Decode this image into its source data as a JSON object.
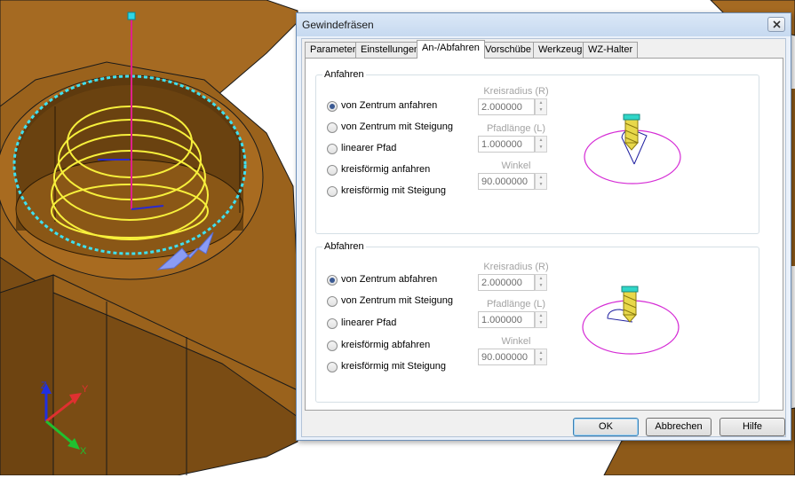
{
  "dialog": {
    "title": "Gewindefräsen",
    "tabs": [
      {
        "label": "Parameter"
      },
      {
        "label": "Einstellungen"
      },
      {
        "label": "An-/Abfahren",
        "active": true
      },
      {
        "label": "Vorschübe"
      },
      {
        "label": "Werkzeug"
      },
      {
        "label": "WZ-Halter"
      }
    ],
    "approach": {
      "group_label": "Anfahren",
      "options": [
        {
          "label": "von Zentrum anfahren",
          "checked": true
        },
        {
          "label": "von Zentrum mit Steigung",
          "checked": false
        },
        {
          "label": "linearer Pfad",
          "checked": false
        },
        {
          "label": "kreisförmig anfahren",
          "checked": false
        },
        {
          "label": "kreisförmig mit Steigung",
          "checked": false
        }
      ],
      "fields": [
        {
          "label": "Kreisradius (R)",
          "value": "2.000000"
        },
        {
          "label": "Pfadlänge (L)",
          "value": "1.000000"
        },
        {
          "label": "Winkel",
          "value": "90.000000"
        }
      ]
    },
    "retract": {
      "group_label": "Abfahren",
      "options": [
        {
          "label": "von Zentrum abfahren",
          "checked": true
        },
        {
          "label": "von Zentrum mit Steigung",
          "checked": false
        },
        {
          "label": "linearer Pfad",
          "checked": false
        },
        {
          "label": "kreisförmig abfahren",
          "checked": false
        },
        {
          "label": "kreisförmig mit Steigung",
          "checked": false
        }
      ],
      "fields": [
        {
          "label": "Kreisradius (R)",
          "value": "2.000000"
        },
        {
          "label": "Pfadlänge (L)",
          "value": "1.000000"
        },
        {
          "label": "Winkel",
          "value": "90.000000"
        }
      ]
    },
    "buttons": {
      "ok": "OK",
      "cancel": "Abbrechen",
      "help": "Hilfe"
    }
  },
  "viewport": {
    "axis_labels": {
      "x": "X",
      "y": "Y",
      "z": "Z"
    },
    "colors": {
      "part": "#a0661d",
      "toolpath": "#f7f03c",
      "boundary": "#3fe0f0",
      "tool_axis": "#e0208c",
      "arrow": "#8a9cf5"
    }
  }
}
